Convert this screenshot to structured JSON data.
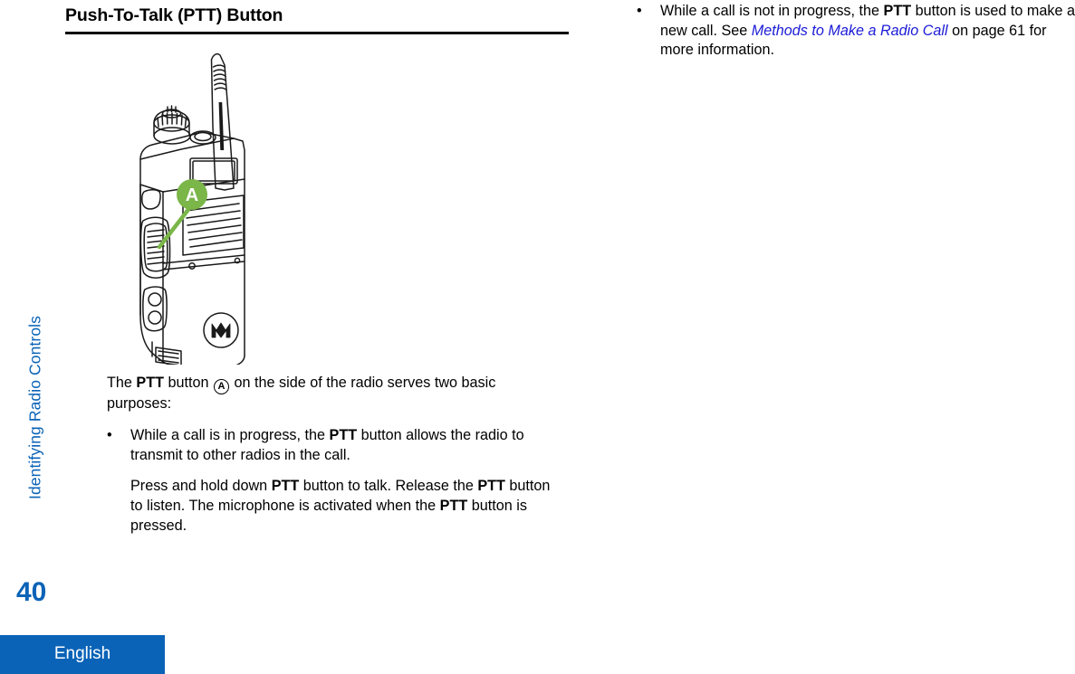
{
  "document": {
    "chapter_tab_label": "Identifying Radio Controls",
    "page_number": "40",
    "language_label": "English",
    "accent_color": "#0a63b7",
    "link_color": "#1b1bd6",
    "callout_color": "#7ab648"
  },
  "left_column": {
    "heading": "Push-To-Talk (PTT) Button",
    "figure": {
      "name": "two-way-radio-illustration",
      "callout_label": "A",
      "callout_color": "#7ab648",
      "brand_mark": "motorola-batwing-logo"
    },
    "intro": {
      "part1": "The ",
      "bold1": "PTT",
      "part2": " button ",
      "circled_icon": "A",
      "part3": " on the side of the radio serves two basic purposes:"
    },
    "bullets": [
      {
        "mark": "•",
        "part1": "While a call is in progress, the ",
        "bold1": "PTT",
        "part2": " button allows the radio to transmit to other radios in the call."
      }
    ],
    "indent_paragraph": {
      "part1": "Press and hold down ",
      "bold1": "PTT",
      "part2": " button to talk. Release the ",
      "bold2": "PTT",
      "part3": " button to listen. The microphone is activated when the ",
      "bold3": "PTT",
      "part4": " button is pressed."
    }
  },
  "right_column": {
    "bullets": [
      {
        "mark": "•",
        "part1": "While a call is not in progress, the ",
        "bold1": "PTT",
        "part2": " button is used to make a new call. See ",
        "link": "Methods to Make a Radio Call",
        "part3": " on page 61 for more information."
      }
    ]
  }
}
